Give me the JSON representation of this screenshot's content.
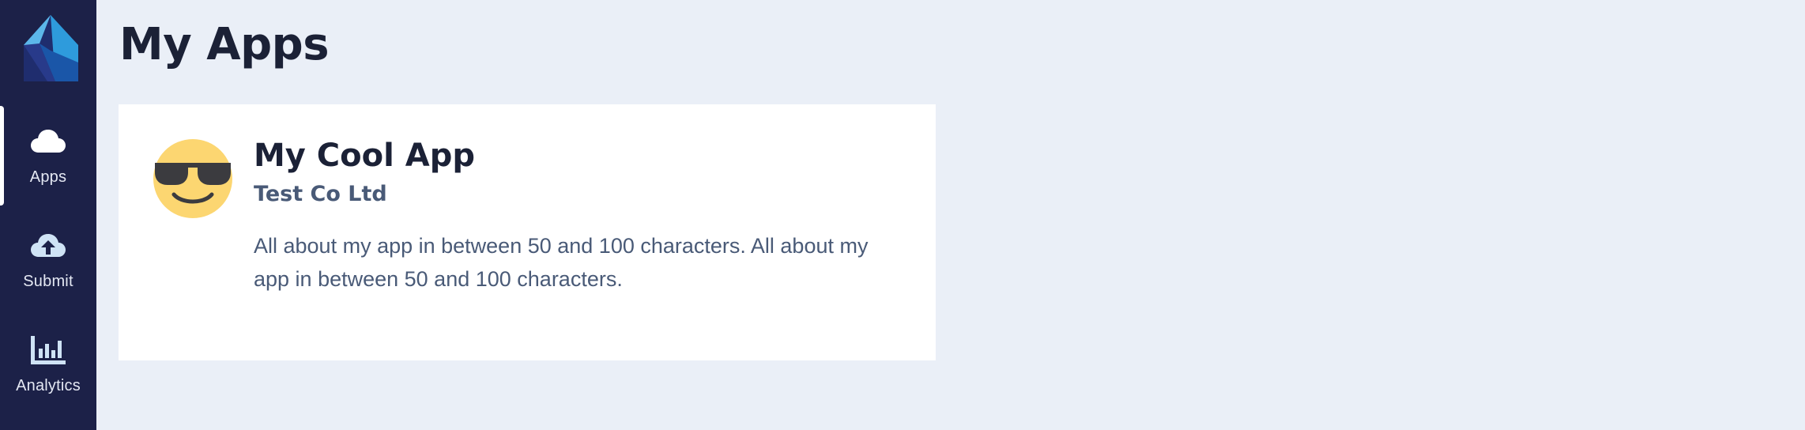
{
  "sidebar": {
    "logo_icon": "house-logo-icon",
    "items": [
      {
        "label": "Apps",
        "icon": "cloud-icon",
        "active": true
      },
      {
        "label": "Submit",
        "icon": "cloud-upload-icon",
        "active": false
      },
      {
        "label": "Analytics",
        "icon": "bar-chart-icon",
        "active": false
      }
    ]
  },
  "main": {
    "title": "My Apps",
    "apps": [
      {
        "icon": "sunglasses-face-icon",
        "name": "My Cool App",
        "company": "Test Co Ltd",
        "description": "All about my app in between 50 and 100 characters. All about my app in between 50 and 100 characters."
      }
    ]
  },
  "colors": {
    "sidebar_bg": "#1c2148",
    "page_bg": "#eaeff7",
    "card_bg": "#ffffff",
    "heading": "#1b2136",
    "body_text": "#495a77",
    "accent_blue": "#2e9bdc",
    "avatar_yellow": "#fcd671"
  }
}
